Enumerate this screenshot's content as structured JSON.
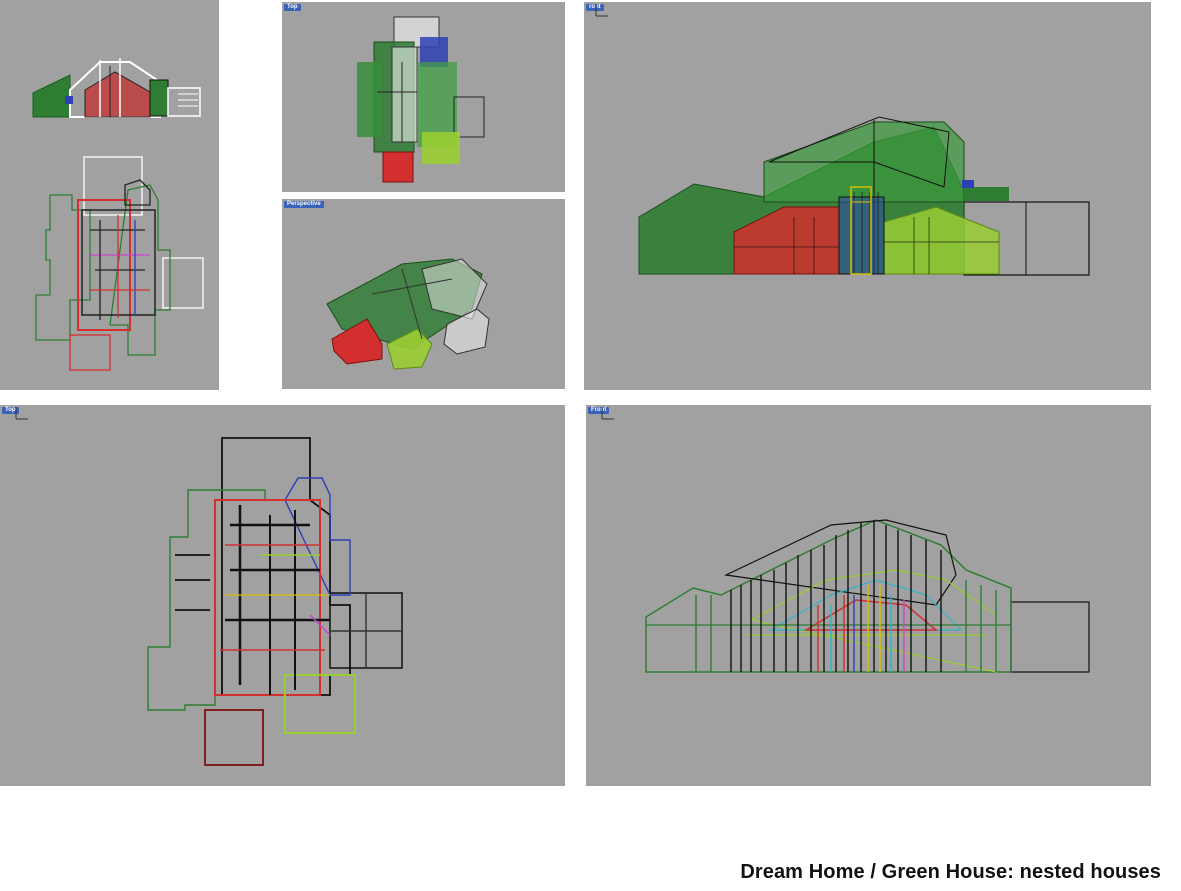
{
  "caption": "Dream Home / Green House: nested houses",
  "viewports": {
    "left_panel": {
      "label": ""
    },
    "top_small": {
      "label": "Top"
    },
    "perspective_small": {
      "label": "Perspective"
    },
    "front_right": {
      "label": "ront"
    },
    "top_bottom": {
      "label": "Top"
    },
    "front_bottom": {
      "label": "Front"
    }
  },
  "colors": {
    "viewport_bg": "#a1a1a1",
    "label_bg": "#3a62b8",
    "green_dark": "#2e7d32",
    "green_light": "#9acd32",
    "red": "#d32f2f",
    "blue": "#2f3fb5",
    "black": "#111111",
    "white": "#ffffff",
    "magenta": "#cc44cc"
  }
}
